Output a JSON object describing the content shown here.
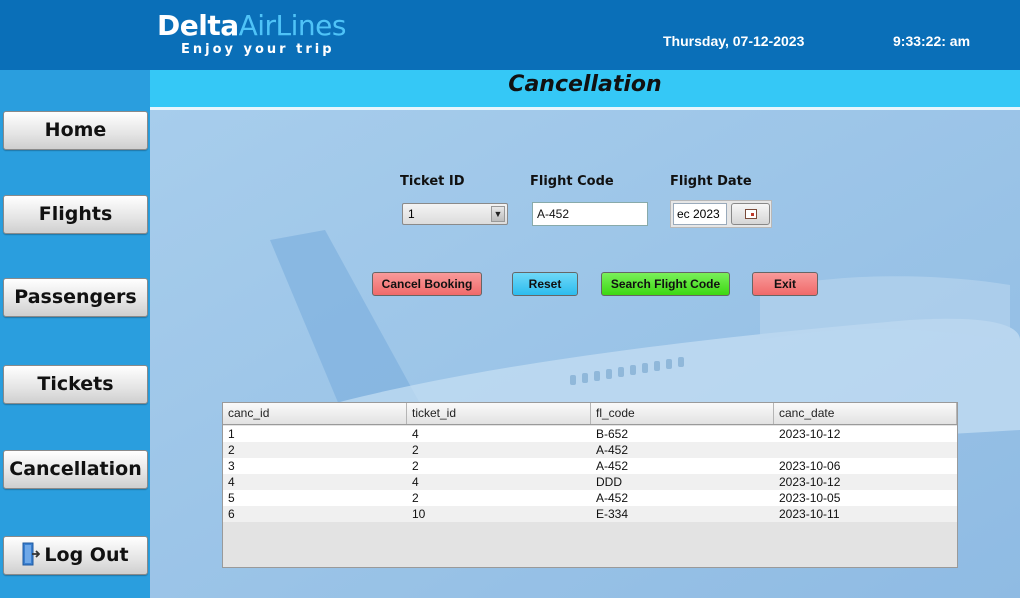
{
  "header": {
    "logo_part1": "Delta",
    "logo_part2": "AirLines",
    "tagline": "Enjoy your trip",
    "date": "Thursday, 07-12-2023",
    "time": "9:33:22: am"
  },
  "sidebar": {
    "items": [
      {
        "label": "Home"
      },
      {
        "label": "Flights"
      },
      {
        "label": "Passengers"
      },
      {
        "label": "Tickets"
      },
      {
        "label": "Cancellation"
      },
      {
        "label": "Log Out"
      }
    ]
  },
  "page": {
    "title": "Cancellation"
  },
  "form": {
    "ticket_id_label": "Ticket ID",
    "ticket_id_value": "1",
    "flight_code_label": "Flight Code",
    "flight_code_value": "A-452",
    "flight_date_label": "Flight Date",
    "flight_date_value": "ec 2023"
  },
  "actions": {
    "cancel_booking": "Cancel Booking",
    "reset": "Reset",
    "search_flight_code": "Search Flight Code",
    "exit": "Exit"
  },
  "table": {
    "columns": [
      "canc_id",
      "ticket_id",
      "fl_code",
      "canc_date"
    ],
    "rows": [
      [
        "1",
        "4",
        "B-652",
        "2023-10-12"
      ],
      [
        "2",
        "2",
        "A-452",
        ""
      ],
      [
        "3",
        "2",
        "A-452",
        "2023-10-06"
      ],
      [
        "4",
        "4",
        "DDD",
        "2023-10-12"
      ],
      [
        "5",
        "2",
        "A-452",
        "2023-10-05"
      ],
      [
        "6",
        "10",
        "E-334",
        "2023-10-11"
      ]
    ]
  },
  "colors": {
    "topbar": "#0a6fb8",
    "sidebar": "#2a9ede",
    "header_band": "#35c8f6",
    "cancel_button": "#f47a7a",
    "reset_button": "#3fc8f4",
    "search_button": "#4fe02a",
    "exit_button": "#f47a7a"
  },
  "icons": {
    "logout": "exit-door-icon",
    "calendar": "calendar-icon",
    "dropdown": "chevron-down-icon"
  }
}
